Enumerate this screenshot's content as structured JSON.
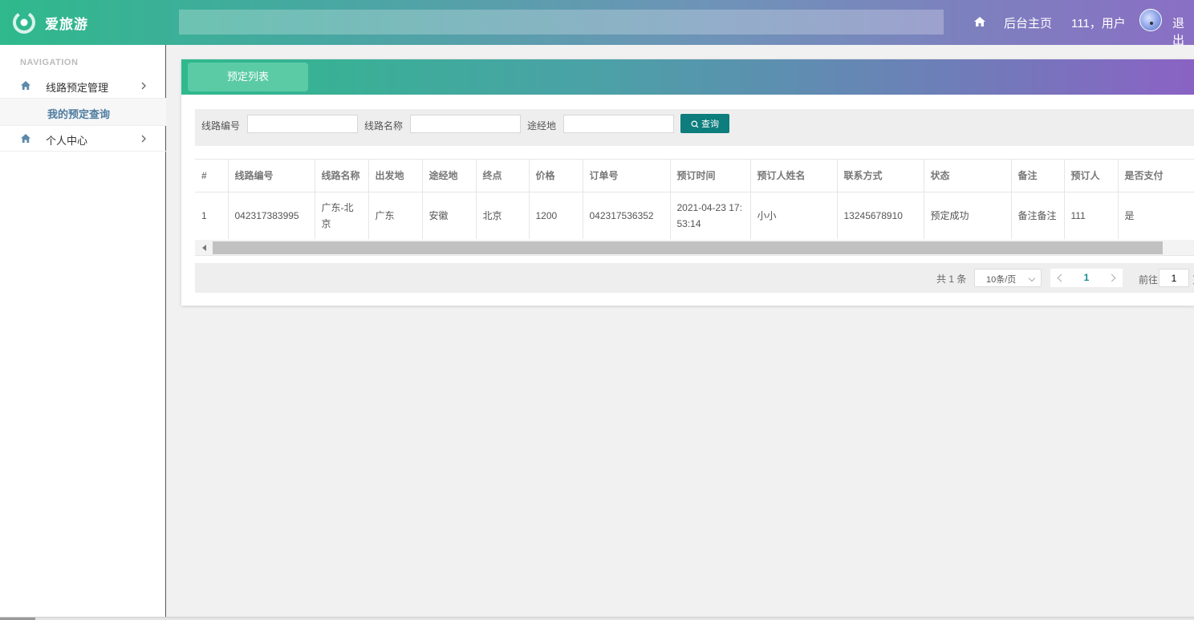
{
  "header": {
    "brand": "爱旅游",
    "search_placeholder": "",
    "home_link": "后台主页",
    "user_label": "111，用户",
    "logout": "退出"
  },
  "sidebar": {
    "title": "NAVIGATION",
    "items": [
      {
        "label": "线路预定管理",
        "icon": "home-icon",
        "expanded": true
      },
      {
        "label": "个人中心",
        "icon": "home-icon",
        "expanded": false
      }
    ],
    "sub_items": [
      {
        "label": "我的预定查询",
        "active": true
      }
    ]
  },
  "panel": {
    "tab_label": "预定列表"
  },
  "search": {
    "route_no_label": "线路编号",
    "route_name_label": "线路名称",
    "via_label": "途经地",
    "route_no_value": "",
    "route_name_value": "",
    "via_value": "",
    "query_button": "查询"
  },
  "table": {
    "columns": [
      "#",
      "线路编号",
      "线路名称",
      "出发地",
      "途经地",
      "终点",
      "价格",
      "订单号",
      "预订时间",
      "预订人姓名",
      "联系方式",
      "状态",
      "备注",
      "预订人",
      "是否支付"
    ],
    "rows": [
      [
        "1",
        "042317383995",
        "广东-北京",
        "广东",
        "安徽",
        "北京",
        "1200",
        "042317536352",
        "2021-04-23 17:53:14",
        "小小",
        "13245678910",
        "预定成功",
        "备注备注",
        "111",
        "是"
      ]
    ]
  },
  "pager": {
    "total": "共 1 条",
    "page_size": "10条/页",
    "current_page": "1",
    "goto_label": "前往",
    "goto_value": "1",
    "goto_suffix": "页"
  },
  "colors": {
    "accent": "#2fb98c",
    "query_button": "#0d7d7d",
    "purple": "#8a62c4"
  }
}
